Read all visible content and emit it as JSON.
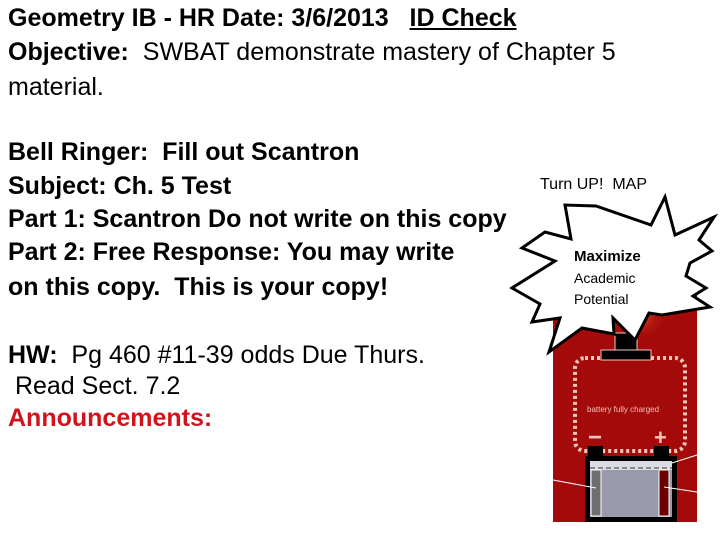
{
  "header": {
    "course": "Geometry  IB - HR  Date: 3/6/2013",
    "id_check": "ID Check"
  },
  "objective": {
    "label": "Objective:",
    "text": "  SWBAT demonstrate mastery of Chapter 5",
    "continuation": "material."
  },
  "agenda": {
    "bell_ringer": "Bell Ringer:  Fill out Scantron",
    "subject": "Subject: Ch. 5 Test",
    "part1": "Part 1: Scantron Do not write on this copy",
    "part2": "Part 2: Free Response: You may write",
    "part2_cont": "on this copy.  This is your copy!"
  },
  "homework": {
    "label": "HW:",
    "text": "  Pg 460 #11-39 odds Due Thurs.",
    "read": " Read Sect. 7.2"
  },
  "announcements": {
    "label": "Announcements:"
  },
  "callout": {
    "turn_up": "Turn UP!  MAP",
    "line1": "Maximize",
    "line2": "Academic",
    "line3": "Potential"
  },
  "battery_graphic": {
    "label": "battery fully charged",
    "minus": "−",
    "plus": "+",
    "colors": {
      "background": "#a50a0a",
      "case": "#000000",
      "cell": "#9a9aad",
      "negative_plate": "#6e6e6e",
      "positive_plate": "#6a0000"
    }
  },
  "colors": {
    "announcement": "#d0141c",
    "text": "#000000"
  }
}
